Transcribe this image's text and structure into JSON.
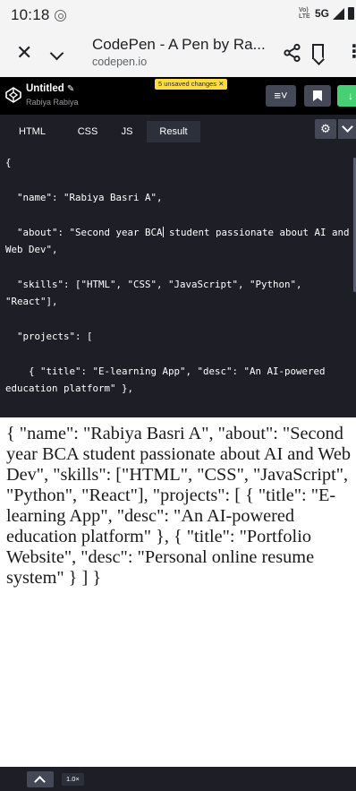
{
  "status_bar": {
    "time": "10:18",
    "volte_label": "Vo) LTE",
    "network": "5G"
  },
  "browser": {
    "page_title": "CodePen - A Pen by Ra...",
    "url": "codepen.io"
  },
  "codepen": {
    "pen_title": "Untitled",
    "author": "Rabiya Rabiya",
    "unsaved_badge": "5 unsaved changes",
    "unsaved_close": "✕"
  },
  "editor_tabs": [
    "HTML",
    "CSS",
    "JS",
    "Result"
  ],
  "selected_tab": "Result",
  "code": {
    "before_caret": "{\n\n  \"name\": \"Rabiya Basri A\",\n\n  \"about\": \"Second year BCA",
    "after_caret": " student passionate about AI and Web Dev\",\n\n  \"skills\": [\"HTML\", \"CSS\", \"JavaScript\", \"Python\", \"React\"],\n\n  \"projects\": [\n\n    { \"title\": \"E-learning App\", \"desc\": \"An AI-powered education platform\" },\n\n    { \"title\": \"Portfolio Website\", \"desc\": \"Personal online resume system\" }"
  },
  "result_text": "{ \"name\": \"Rabiya Basri A\", \"about\": \"Second year BCA student passionate about AI and Web Dev\", \"skills\": [\"HTML\", \"CSS\", \"JavaScript\", \"Python\", \"React\"], \"projects\": [ { \"title\": \"E-learning App\", \"desc\": \"An AI-powered education platform\" }, { \"title\": \"Portfolio Website\", \"desc\": \"Personal online resume system\" } ] }",
  "bottom_bar": {
    "zoom": "1.0×"
  },
  "icons": {
    "close": "close-icon",
    "chevron": "chevron-down-icon",
    "share": "share-icon",
    "bookmark": "bookmark-icon",
    "more": "more-vert-icon",
    "codepen_logo": "codepen-logo-icon",
    "settings": "gear-icon",
    "collapse": "chevron-up-icon"
  },
  "colors": {
    "editor_bg": "#1e1f26",
    "header_bg": "#000000",
    "accent_green": "#47cf73",
    "unsaved_yellow": "#ffdd40"
  }
}
